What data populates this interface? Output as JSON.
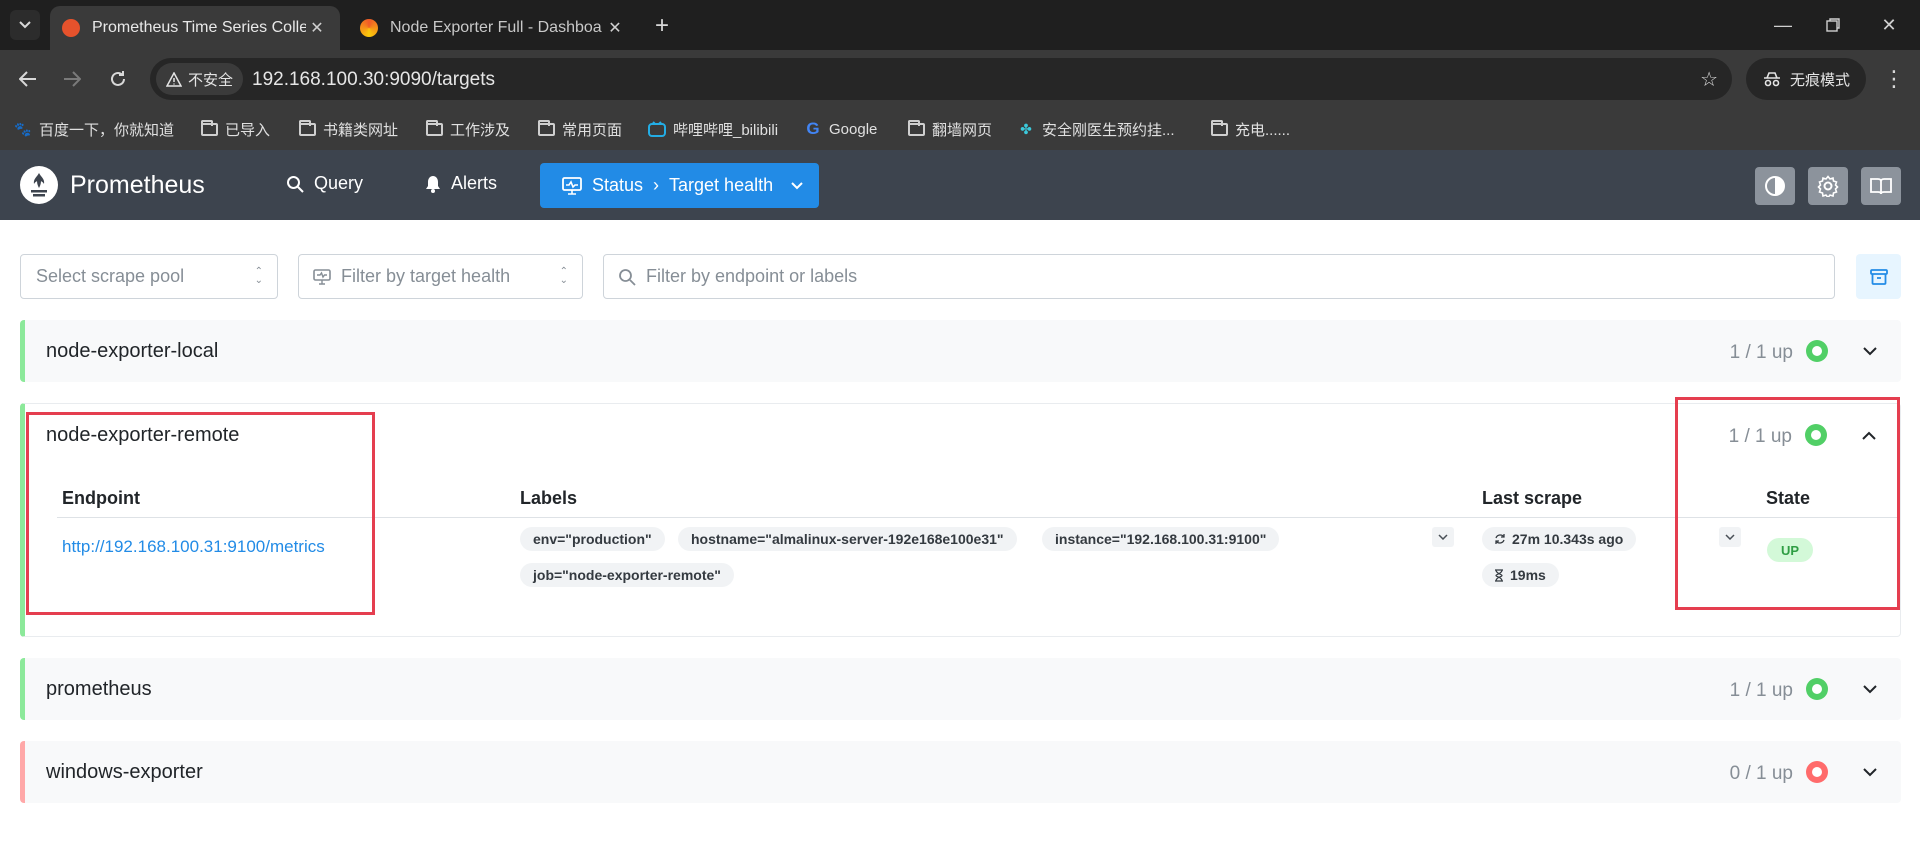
{
  "browser": {
    "tabs": [
      {
        "title": "Prometheus Time Series Colle",
        "active": true
      },
      {
        "title": "Node Exporter Full - Dashboa",
        "active": false
      }
    ],
    "security_label": "不安全",
    "url": "192.168.100.30:9090/targets",
    "incognito_label": "无痕模式",
    "bookmarks": [
      {
        "label": "百度一下，你就知道",
        "icon": "baidu-icon"
      },
      {
        "label": "已导入",
        "icon": "folder-icon"
      },
      {
        "label": "书籍类网址",
        "icon": "folder-icon"
      },
      {
        "label": "工作涉及",
        "icon": "folder-icon"
      },
      {
        "label": "常用页面",
        "icon": "folder-icon"
      },
      {
        "label": "哔哩哔哩_bilibili",
        "icon": "bilibili-icon"
      },
      {
        "label": "Google",
        "icon": "google-icon"
      },
      {
        "label": "翻墙网页",
        "icon": "folder-icon"
      },
      {
        "label": "安全刚医生预约挂...",
        "icon": "app-icon"
      },
      {
        "label": "充电......",
        "icon": "folder-icon"
      }
    ]
  },
  "header": {
    "brand": "Prometheus",
    "query_label": "Query",
    "alerts_label": "Alerts",
    "status_label": "Status",
    "status_separator": "›",
    "status_page": "Target health"
  },
  "filters": {
    "scrape_pool_placeholder": "Select scrape pool",
    "health_placeholder": "Filter by target health",
    "search_placeholder": "Filter by endpoint or labels"
  },
  "pools": [
    {
      "name": "node-exporter-local",
      "count": "1 / 1 up",
      "status": "up",
      "expanded": false
    },
    {
      "name": "node-exporter-remote",
      "count": "1 / 1 up",
      "status": "up",
      "expanded": true
    },
    {
      "name": "prometheus",
      "count": "1 / 1 up",
      "status": "up",
      "expanded": false
    },
    {
      "name": "windows-exporter",
      "count": "0 / 1 up",
      "status": "down",
      "expanded": false
    }
  ],
  "table": {
    "headers": {
      "endpoint": "Endpoint",
      "labels": "Labels",
      "last_scrape": "Last scrape",
      "state": "State"
    },
    "row": {
      "endpoint": "http://192.168.100.31:9100/metrics",
      "labels": [
        "env=\"production\"",
        "hostname=\"almalinux-server-192e168e100e31\"",
        "instance=\"192.168.100.31:9100\"",
        "job=\"node-exporter-remote\""
      ],
      "last_scrape_ago": "27m 10.343s ago",
      "scrape_duration": "19ms",
      "state": "UP"
    }
  },
  "colors": {
    "accent": "#228be6",
    "up_green": "#51cf66",
    "down_red": "#ff6b6b",
    "highlight_box": "#e53e4f"
  }
}
